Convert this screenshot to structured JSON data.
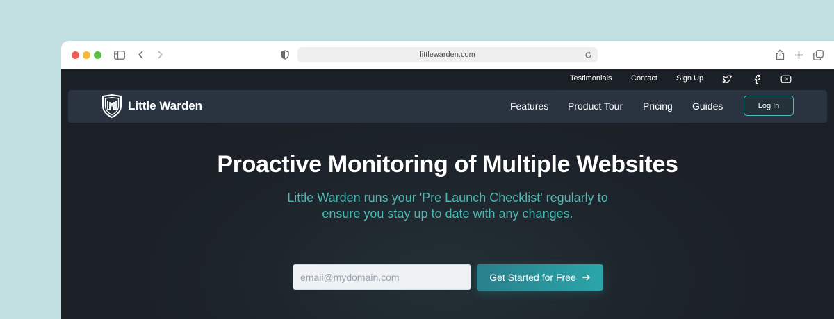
{
  "browser": {
    "url": "littlewarden.com",
    "icons": [
      "close-dot",
      "minimize-dot",
      "zoom-dot",
      "sidebar-icon",
      "back-icon",
      "forward-icon",
      "shield-icon",
      "reload-icon",
      "share-icon",
      "new-tab-icon",
      "tabs-icon"
    ]
  },
  "topbar": {
    "links": [
      "Testimonials",
      "Contact",
      "Sign Up"
    ],
    "social": [
      "twitter-icon",
      "facebook-icon",
      "youtube-icon"
    ]
  },
  "navbar": {
    "brand": "Little Warden",
    "logo": "shield-logo-icon",
    "links": [
      "Features",
      "Product Tour",
      "Pricing",
      "Guides"
    ],
    "login_label": "Log In"
  },
  "hero": {
    "title": "Proactive Monitoring of Multiple Websites",
    "subtitle_line1": "Little Warden runs your 'Pre Launch Checklist' regularly to",
    "subtitle_line2": "ensure you stay up to date with any changes.",
    "email_placeholder": "email@mydomain.com",
    "cta_label": "Get Started for Free"
  },
  "colors": {
    "page_bg": "#c2e0e2",
    "site_bg": "#1d2128",
    "navbar_bg": "#2a3440",
    "accent": "#4cb8b3",
    "cta": "#2aa6a8"
  }
}
